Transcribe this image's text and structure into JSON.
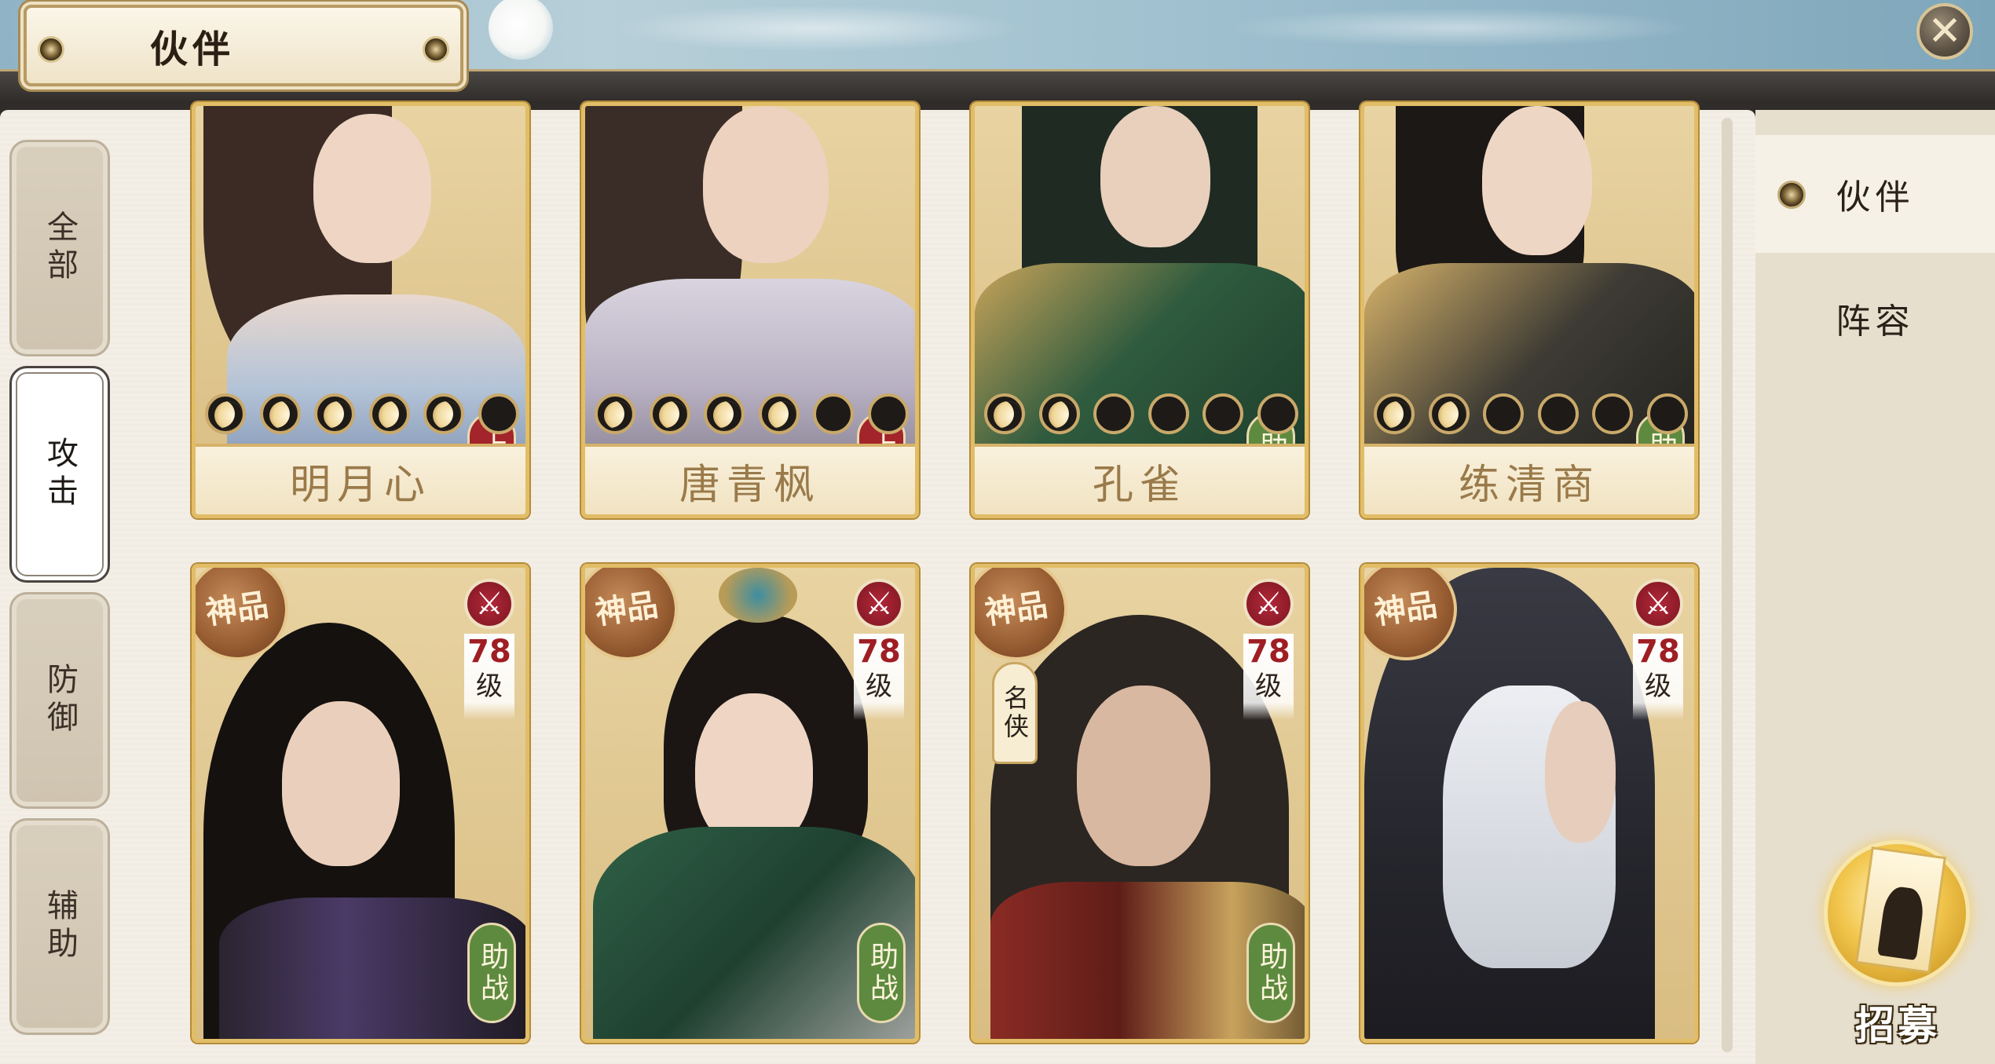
{
  "header": {
    "title": "伙伴",
    "close_icon": "close-x-icon"
  },
  "category_tabs": [
    {
      "label": "全部",
      "active": false
    },
    {
      "label": "攻击",
      "active": true
    },
    {
      "label": "防御",
      "active": false
    },
    {
      "label": "辅助",
      "active": false
    }
  ],
  "partners_top": [
    {
      "name": "明月心",
      "status": "上阵",
      "stars_lit": 5,
      "stars_total": 6
    },
    {
      "name": "唐青枫",
      "status": "上阵",
      "stars_lit": 4,
      "stars_total": 6
    },
    {
      "name": "孔雀",
      "status": "助战",
      "stars_lit": 2,
      "stars_total": 6
    },
    {
      "name": "练清商",
      "status": "助战",
      "stars_lit": 2,
      "stars_total": 6
    }
  ],
  "partners_bottom": [
    {
      "rank": "神品",
      "level": "78",
      "level_unit": "级",
      "status": "助战",
      "fame": ""
    },
    {
      "rank": "神品",
      "level": "78",
      "level_unit": "级",
      "status": "助战",
      "fame": ""
    },
    {
      "rank": "神品",
      "level": "78",
      "level_unit": "级",
      "status": "助战",
      "fame": "名侠"
    },
    {
      "rank": "神品",
      "level": "78",
      "level_unit": "级",
      "status": "",
      "fame": ""
    }
  ],
  "side_menu": [
    {
      "label": "伙伴",
      "active": true
    },
    {
      "label": "阵容",
      "active": false
    }
  ],
  "recruit": {
    "label": "招募",
    "icon": "recruit-card-icon"
  },
  "colors": {
    "deploy_badge": "#a3242a",
    "assist_badge": "#5d8a3f",
    "card_frame": "#e1bd67",
    "panel_bg": "#f3efe6"
  }
}
